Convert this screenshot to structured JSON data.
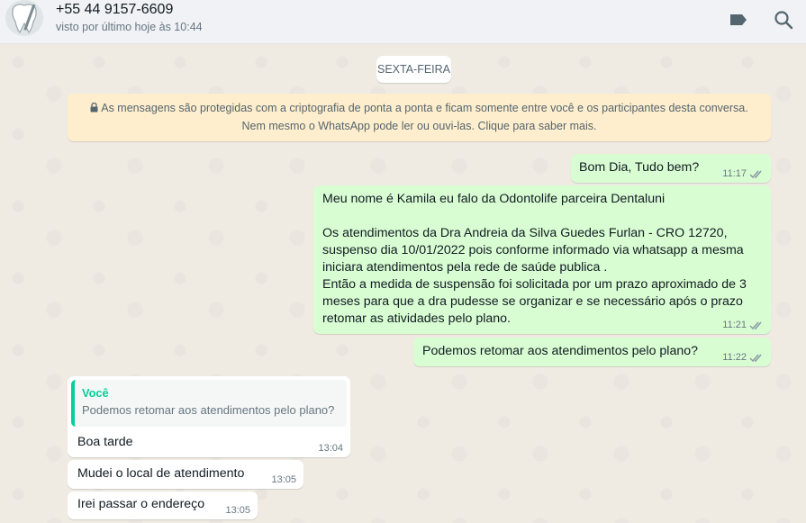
{
  "header": {
    "contact_name": "+55 44 9157-6609",
    "status": "visto por último hoje às 10:44",
    "icons": [
      "label-icon",
      "search-icon"
    ]
  },
  "chat": {
    "date_chip": "SEXTA-FEIRA",
    "encryption": {
      "line1": "As mensagens são protegidas com a criptografia de ponta a ponta e ficam somente entre você e os participantes desta conversa.",
      "line2": "Nem mesmo o WhatsApp pode ler ou ouvi-las. Clique para saber mais."
    },
    "messages": [
      {
        "direction": "out",
        "text": "Bom Dia, Tudo bem?",
        "time": "11:17",
        "status": "read"
      },
      {
        "direction": "out",
        "text": "Meu nome é Kamila eu falo da Odontolife parceira Dentaluni\n\nOs atendimentos da Dra Andreia da Silva Guedes Furlan - CRO 12720,\nsuspenso dia 10/01/2022 pois conforme informado via whatsapp a mesma\niniciara atendimentos pela rede de saúde publica .\nEntão a medida de suspensão foi solicitada por um prazo aproximado de 3\nmeses para que a dra pudesse se organizar e se necessário após o prazo\nretomar as atividades pelo plano.",
        "time": "11:21",
        "status": "read"
      },
      {
        "direction": "out",
        "text": "Podemos retomar aos atendimentos pelo plano?",
        "time": "11:22",
        "status": "read"
      },
      {
        "direction": "in",
        "quote": {
          "author": "Você",
          "text": "Podemos retomar aos atendimentos pelo plano?"
        },
        "text": "Boa tarde",
        "time": "13:04"
      },
      {
        "direction": "in",
        "text": "Mudei o local de atendimento",
        "time": "13:05"
      },
      {
        "direction": "in",
        "text": "Irei passar o endereço",
        "time": "13:05"
      }
    ]
  },
  "colors": {
    "outgoing_bubble": "#d9fdd3",
    "incoming_bubble": "#ffffff",
    "read_ticks": "#8696a0",
    "quote_accent": "#06cf9c",
    "encryption_bg": "#ffeecd"
  }
}
